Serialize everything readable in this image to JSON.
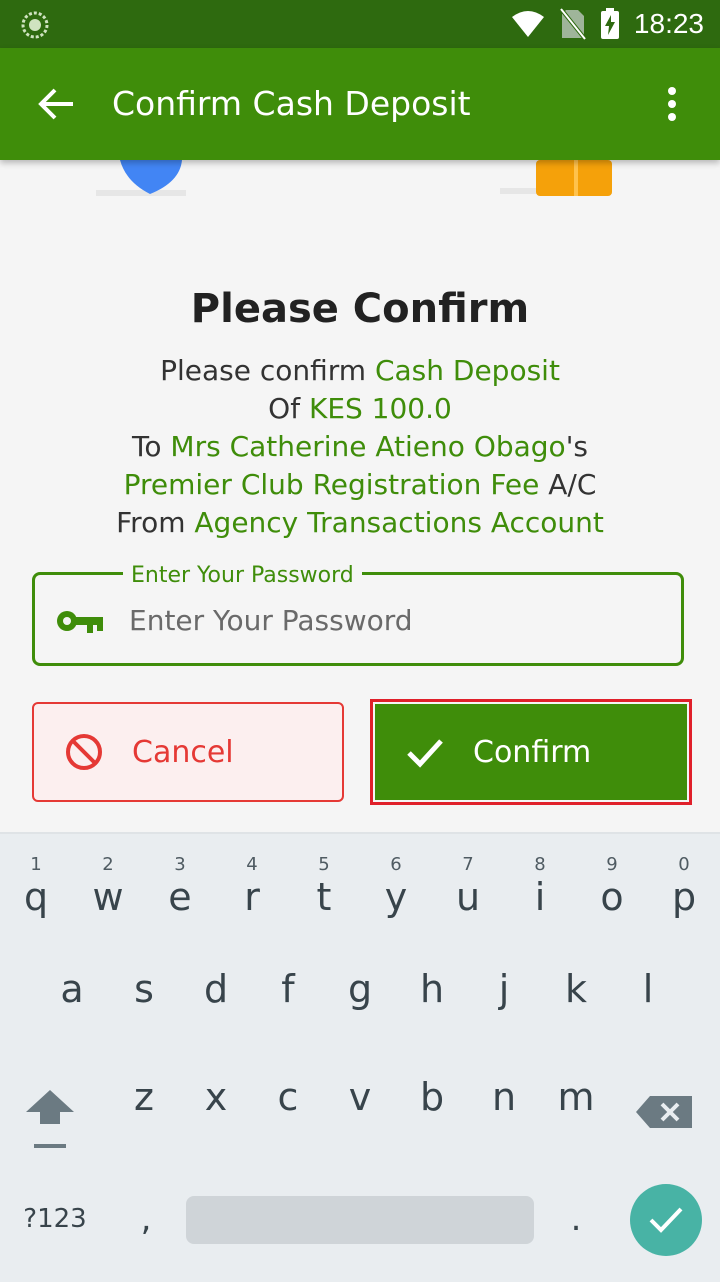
{
  "status_bar": {
    "time": "18:23",
    "icons": [
      "wifi-icon",
      "no-sim-icon",
      "battery-charging-icon"
    ]
  },
  "app_bar": {
    "title": "Confirm Cash Deposit",
    "back_icon": "arrow-back-icon",
    "menu_icon": "more-vert-icon"
  },
  "confirm": {
    "title": "Please Confirm",
    "line1_prefix": "Please confirm ",
    "line1_value": "Cash Deposit",
    "line2_prefix": "Of ",
    "line2_value": "KES 100.0",
    "line3_prefix": "To ",
    "line3_value": "Mrs Catherine Atieno Obago",
    "line3_suffix": "'s",
    "line4_value": "Premier Club Registration Fee",
    "line4_suffix": " A/C",
    "line5_prefix": "From ",
    "line5_value": "Agency Transactions Account"
  },
  "password": {
    "label": "Enter Your Password",
    "placeholder": "Enter Your Password",
    "value": ""
  },
  "actions": {
    "cancel_label": "Cancel",
    "confirm_label": "Confirm"
  },
  "colors": {
    "primary": "#3f8d0a",
    "status_bar": "#2e6a0f",
    "cancel": "#e53935",
    "highlight_frame": "#e0202a",
    "enter_key": "#48b3a5"
  },
  "keyboard": {
    "row1": [
      {
        "ch": "q",
        "num": "1"
      },
      {
        "ch": "w",
        "num": "2"
      },
      {
        "ch": "e",
        "num": "3"
      },
      {
        "ch": "r",
        "num": "4"
      },
      {
        "ch": "t",
        "num": "5"
      },
      {
        "ch": "y",
        "num": "6"
      },
      {
        "ch": "u",
        "num": "7"
      },
      {
        "ch": "i",
        "num": "8"
      },
      {
        "ch": "o",
        "num": "9"
      },
      {
        "ch": "p",
        "num": "0"
      }
    ],
    "row2": [
      "a",
      "s",
      "d",
      "f",
      "g",
      "h",
      "j",
      "k",
      "l"
    ],
    "row3": [
      "z",
      "x",
      "c",
      "v",
      "b",
      "n",
      "m"
    ],
    "symbols_label": "?123",
    "comma": ",",
    "period": "."
  }
}
